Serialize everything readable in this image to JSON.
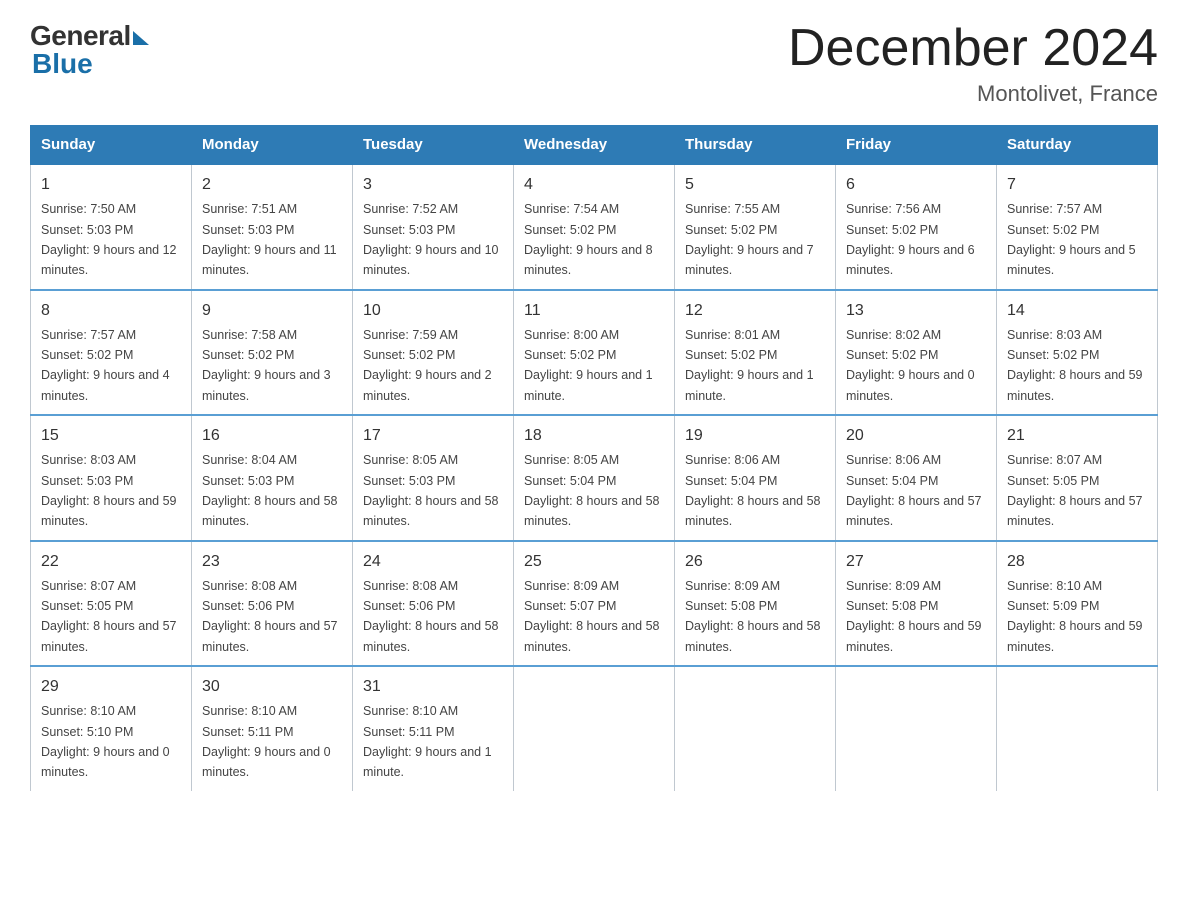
{
  "logo": {
    "general": "General",
    "blue": "Blue"
  },
  "title": "December 2024",
  "location": "Montolivet, France",
  "days_of_week": [
    "Sunday",
    "Monday",
    "Tuesday",
    "Wednesday",
    "Thursday",
    "Friday",
    "Saturday"
  ],
  "weeks": [
    [
      {
        "day": "1",
        "sunrise": "7:50 AM",
        "sunset": "5:03 PM",
        "daylight": "9 hours and 12 minutes."
      },
      {
        "day": "2",
        "sunrise": "7:51 AM",
        "sunset": "5:03 PM",
        "daylight": "9 hours and 11 minutes."
      },
      {
        "day": "3",
        "sunrise": "7:52 AM",
        "sunset": "5:03 PM",
        "daylight": "9 hours and 10 minutes."
      },
      {
        "day": "4",
        "sunrise": "7:54 AM",
        "sunset": "5:02 PM",
        "daylight": "9 hours and 8 minutes."
      },
      {
        "day": "5",
        "sunrise": "7:55 AM",
        "sunset": "5:02 PM",
        "daylight": "9 hours and 7 minutes."
      },
      {
        "day": "6",
        "sunrise": "7:56 AM",
        "sunset": "5:02 PM",
        "daylight": "9 hours and 6 minutes."
      },
      {
        "day": "7",
        "sunrise": "7:57 AM",
        "sunset": "5:02 PM",
        "daylight": "9 hours and 5 minutes."
      }
    ],
    [
      {
        "day": "8",
        "sunrise": "7:57 AM",
        "sunset": "5:02 PM",
        "daylight": "9 hours and 4 minutes."
      },
      {
        "day": "9",
        "sunrise": "7:58 AM",
        "sunset": "5:02 PM",
        "daylight": "9 hours and 3 minutes."
      },
      {
        "day": "10",
        "sunrise": "7:59 AM",
        "sunset": "5:02 PM",
        "daylight": "9 hours and 2 minutes."
      },
      {
        "day": "11",
        "sunrise": "8:00 AM",
        "sunset": "5:02 PM",
        "daylight": "9 hours and 1 minute."
      },
      {
        "day": "12",
        "sunrise": "8:01 AM",
        "sunset": "5:02 PM",
        "daylight": "9 hours and 1 minute."
      },
      {
        "day": "13",
        "sunrise": "8:02 AM",
        "sunset": "5:02 PM",
        "daylight": "9 hours and 0 minutes."
      },
      {
        "day": "14",
        "sunrise": "8:03 AM",
        "sunset": "5:02 PM",
        "daylight": "8 hours and 59 minutes."
      }
    ],
    [
      {
        "day": "15",
        "sunrise": "8:03 AM",
        "sunset": "5:03 PM",
        "daylight": "8 hours and 59 minutes."
      },
      {
        "day": "16",
        "sunrise": "8:04 AM",
        "sunset": "5:03 PM",
        "daylight": "8 hours and 58 minutes."
      },
      {
        "day": "17",
        "sunrise": "8:05 AM",
        "sunset": "5:03 PM",
        "daylight": "8 hours and 58 minutes."
      },
      {
        "day": "18",
        "sunrise": "8:05 AM",
        "sunset": "5:04 PM",
        "daylight": "8 hours and 58 minutes."
      },
      {
        "day": "19",
        "sunrise": "8:06 AM",
        "sunset": "5:04 PM",
        "daylight": "8 hours and 58 minutes."
      },
      {
        "day": "20",
        "sunrise": "8:06 AM",
        "sunset": "5:04 PM",
        "daylight": "8 hours and 57 minutes."
      },
      {
        "day": "21",
        "sunrise": "8:07 AM",
        "sunset": "5:05 PM",
        "daylight": "8 hours and 57 minutes."
      }
    ],
    [
      {
        "day": "22",
        "sunrise": "8:07 AM",
        "sunset": "5:05 PM",
        "daylight": "8 hours and 57 minutes."
      },
      {
        "day": "23",
        "sunrise": "8:08 AM",
        "sunset": "5:06 PM",
        "daylight": "8 hours and 57 minutes."
      },
      {
        "day": "24",
        "sunrise": "8:08 AM",
        "sunset": "5:06 PM",
        "daylight": "8 hours and 58 minutes."
      },
      {
        "day": "25",
        "sunrise": "8:09 AM",
        "sunset": "5:07 PM",
        "daylight": "8 hours and 58 minutes."
      },
      {
        "day": "26",
        "sunrise": "8:09 AM",
        "sunset": "5:08 PM",
        "daylight": "8 hours and 58 minutes."
      },
      {
        "day": "27",
        "sunrise": "8:09 AM",
        "sunset": "5:08 PM",
        "daylight": "8 hours and 59 minutes."
      },
      {
        "day": "28",
        "sunrise": "8:10 AM",
        "sunset": "5:09 PM",
        "daylight": "8 hours and 59 minutes."
      }
    ],
    [
      {
        "day": "29",
        "sunrise": "8:10 AM",
        "sunset": "5:10 PM",
        "daylight": "9 hours and 0 minutes."
      },
      {
        "day": "30",
        "sunrise": "8:10 AM",
        "sunset": "5:11 PM",
        "daylight": "9 hours and 0 minutes."
      },
      {
        "day": "31",
        "sunrise": "8:10 AM",
        "sunset": "5:11 PM",
        "daylight": "9 hours and 1 minute."
      },
      null,
      null,
      null,
      null
    ]
  ]
}
